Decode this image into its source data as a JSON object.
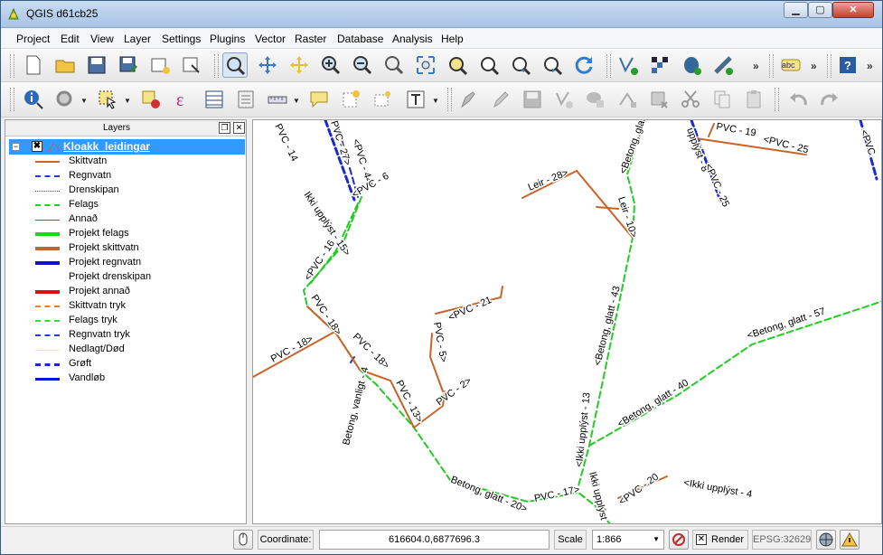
{
  "window": {
    "title": "QGIS d61cb25",
    "min": "▁",
    "max": "▢",
    "close": "✕"
  },
  "menubar": {
    "items": [
      "Project",
      "Edit",
      "View",
      "Layer",
      "Settings",
      "Plugins",
      "Vector",
      "Raster",
      "Database",
      "Analysis",
      "Help"
    ]
  },
  "toolbar": {
    "more": "»",
    "abc_label": "abc",
    "help_label": "?"
  },
  "layers_panel": {
    "title": "Layers",
    "float_btn": "❐",
    "close_btn": "✕",
    "root": {
      "name": "Kloakk_leidingar",
      "checked": "✖",
      "expander": "−"
    },
    "items": [
      {
        "label": "Skittvatn",
        "color": "#c8642a",
        "style": "solid",
        "width": 2
      },
      {
        "label": "Regnvatn",
        "color": "#1f3fc8",
        "style": "dashed",
        "width": 2
      },
      {
        "label": "Drenskipan",
        "color": "#c02020",
        "style": "dotted",
        "width": 1
      },
      {
        "label": "Felags",
        "color": "#22cc22",
        "style": "dashed",
        "width": 2
      },
      {
        "label": "Annað",
        "color": "#aa33aa",
        "style": "solid",
        "width": 1
      },
      {
        "label": "Projekt felags",
        "color": "#11dd11",
        "style": "solid",
        "width": 4
      },
      {
        "label": "Projekt skittvatn",
        "color": "#c8642a",
        "style": "solid",
        "width": 4
      },
      {
        "label": "Projekt regnvatn",
        "color": "#1010cc",
        "style": "solid",
        "width": 4
      },
      {
        "label": "Projekt drenskipan",
        "color": "#ffffff",
        "style": "solid",
        "width": 1
      },
      {
        "label": "Projekt annað",
        "color": "#dd1010",
        "style": "solid",
        "width": 4
      },
      {
        "label": "Skittvatn tryk",
        "color": "#e0802a",
        "style": "dashed",
        "width": 2
      },
      {
        "label": "Felags tryk",
        "color": "#33dd33",
        "style": "dashed",
        "width": 2
      },
      {
        "label": "Regnvatn tryk",
        "color": "#2040cc",
        "style": "dashed",
        "width": 2
      },
      {
        "label": "Nedlagt/Død",
        "color": "#eeee88",
        "style": "solid",
        "width": 1
      },
      {
        "label": "Grøft",
        "color": "#1a2ad0",
        "style": "dashed",
        "width": 3
      },
      {
        "label": "Vandløb",
        "color": "#0a10dd",
        "style": "solid",
        "width": 3
      }
    ]
  },
  "map": {
    "labels": [
      "PVC - 27>",
      "PVC - 14",
      "<PVC - 44>",
      "<PVC - 6",
      "Ikki upplýst - 15>",
      "<PVC - 16",
      "PVC - 18>",
      "PVC - 18>",
      "PVC - 18>",
      "PVC - 13>",
      "Betong, vanligt - 4",
      "PVC - 5>",
      "<PVC - 21",
      "PVC - 2>",
      "Leir - 28>",
      "Leir - 10>",
      "<Betong, glatt - 43",
      "<Betong, glatt",
      "upplýst - 8",
      "<PVC - 25",
      "PVC - 19",
      "<PVC - 25",
      "<PVC",
      "<Betong, glatt - 57",
      "<Betong, glatt - 40",
      "<Ikki upplýst - 13",
      "Betong, glatt - 20>",
      "PVC - 17>",
      "Ikki upplýst",
      "<PVC - 20",
      "<Ikki upplýst - 4"
    ]
  },
  "statusbar": {
    "coordinate_label": "Coordinate:",
    "coordinate_value": "616604.0,6877696.3",
    "scale_label": "Scale",
    "scale_value": "1:866",
    "render_label": "Render",
    "render_checked": "✕",
    "epsg": "EPSG:32629"
  }
}
